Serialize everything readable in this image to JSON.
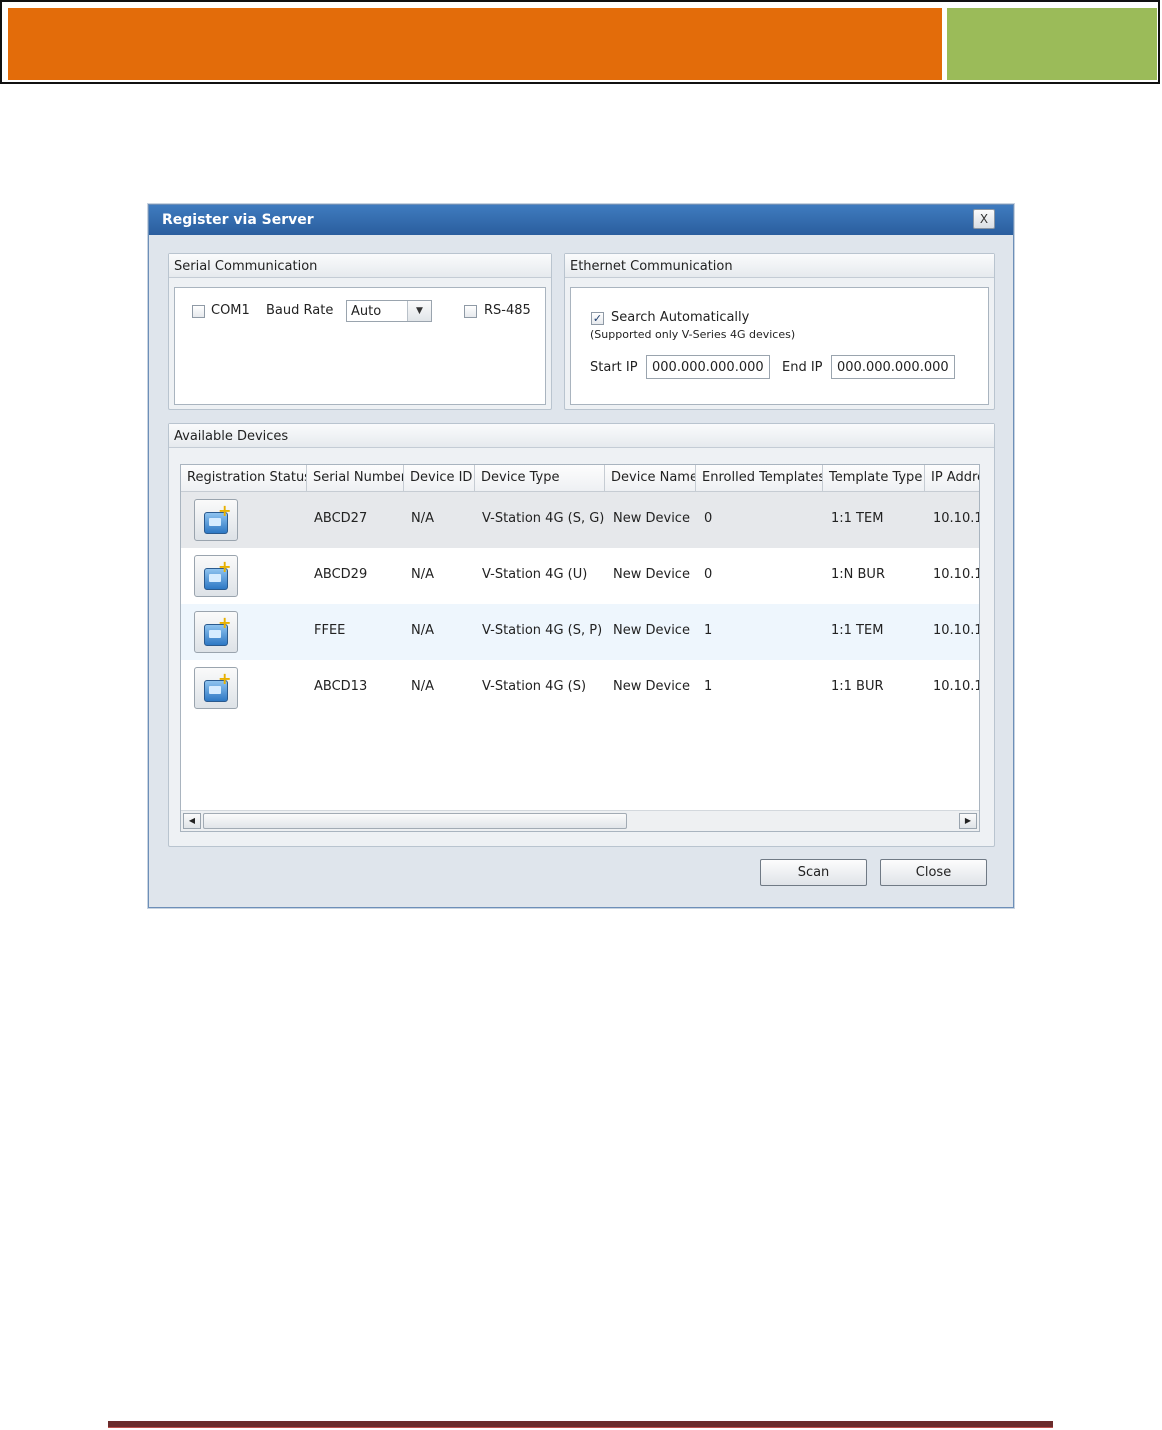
{
  "colors": {
    "banner_primary": "#e36c0a",
    "banner_secondary": "#9bbb59",
    "footer_rule": "#6b2c2c",
    "titlebar": "#2f69ad"
  },
  "dialog": {
    "title": "Register via Server",
    "close_label": "X"
  },
  "serial": {
    "header": "Serial Communication",
    "com_label": "COM1",
    "com_checked": false,
    "baud_label": "Baud Rate",
    "baud_value": "Auto",
    "rs485_label": "RS-485",
    "rs485_checked": false
  },
  "ethernet": {
    "header": "Ethernet Communication",
    "search_label": "Search Automatically",
    "search_checked": true,
    "search_note": "(Supported only V-Series 4G devices)",
    "start_ip_label": "Start IP",
    "start_ip_value": "000.000.000.000",
    "end_ip_label": "End IP",
    "end_ip_value": "000.000.000.000"
  },
  "devices": {
    "header": "Available Devices",
    "columns": [
      "Registration Status",
      "Serial Number",
      "Device ID",
      "Device Type",
      "Device Name",
      "Enrolled Templates",
      "Template Type",
      "IP Addre"
    ],
    "rows": [
      {
        "serial": "ABCD27",
        "device_id": "N/A",
        "device_type": "V-Station 4G (S, G)",
        "device_name": "New Device",
        "enrolled": "0",
        "template_type": "1:1 TEM",
        "ip": "10.10.1."
      },
      {
        "serial": "ABCD29",
        "device_id": "N/A",
        "device_type": "V-Station 4G (U)",
        "device_name": "New Device",
        "enrolled": "0",
        "template_type": "1:N BUR",
        "ip": "10.10.1."
      },
      {
        "serial": "FFEE",
        "device_id": "N/A",
        "device_type": "V-Station 4G (S, P)",
        "device_name": "New Device",
        "enrolled": "1",
        "template_type": "1:1 TEM",
        "ip": "10.10.1."
      },
      {
        "serial": "ABCD13",
        "device_id": "N/A",
        "device_type": "V-Station 4G (S)",
        "device_name": "New Device",
        "enrolled": "1",
        "template_type": "1:1 BUR",
        "ip": "10.10.1."
      }
    ],
    "register_icon": "device-add-icon",
    "scroll_left_icon": "arrow-left-icon",
    "scroll_right_icon": "arrow-right-icon"
  },
  "buttons": {
    "scan": "Scan",
    "close": "Close"
  }
}
